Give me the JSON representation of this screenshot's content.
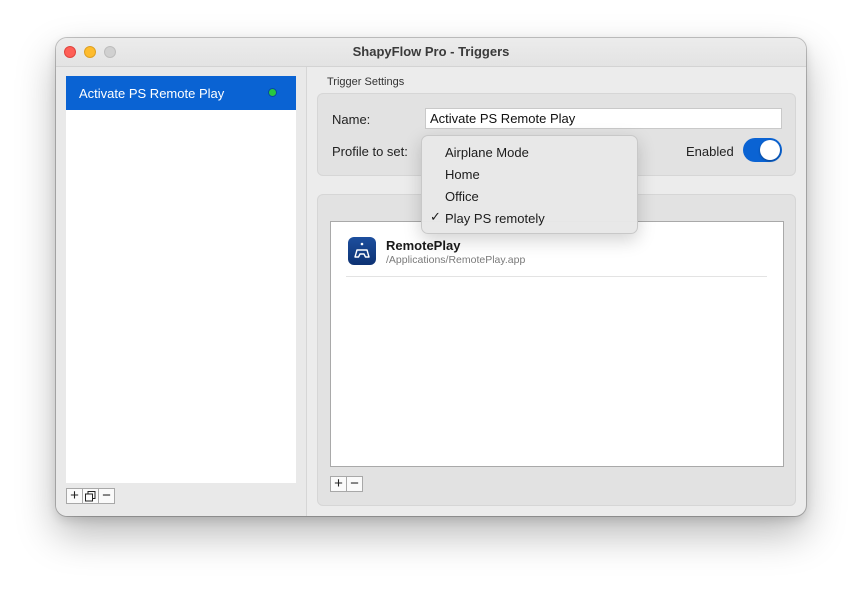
{
  "window": {
    "title": "ShapyFlow Pro - Triggers"
  },
  "sidebar": {
    "items": [
      {
        "label": "Activate PS Remote Play",
        "status_color": "#27c93f"
      }
    ],
    "buttons": {
      "add": "+",
      "duplicate": "⧉",
      "remove": "−"
    }
  },
  "trigger_settings": {
    "section_label": "Trigger Settings",
    "name_label": "Name:",
    "name_value": "Activate PS Remote Play",
    "profile_label": "Profile to set:",
    "enabled_label": "Enabled",
    "enabled": true
  },
  "apps": {
    "items": [
      {
        "name": "RemotePlay",
        "path": "/Applications/RemotePlay.app",
        "icon": "playstation-remote-play-icon"
      }
    ],
    "buttons": {
      "add": "+",
      "remove": "−"
    }
  },
  "profile_menu": {
    "options": [
      "Airplane Mode",
      "Home",
      "Office",
      "Play PS remotely"
    ],
    "selected": "Play PS remotely",
    "check_glyph": "✓"
  },
  "colors": {
    "accent": "#0a63d3",
    "close": "#fe5f57",
    "minimize": "#febc2e",
    "zoom": "#d0d0d0"
  }
}
